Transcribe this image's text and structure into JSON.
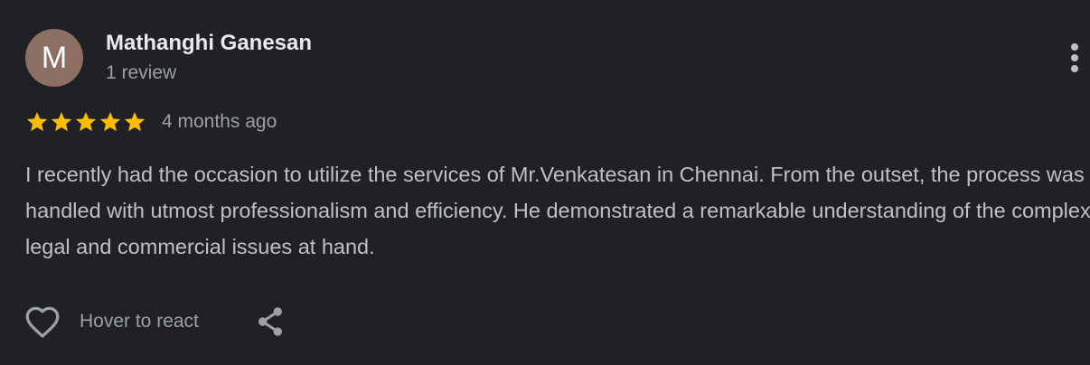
{
  "reviewer": {
    "initial": "M",
    "avatar_color": "#8d6e63",
    "name": "Mathanghi Ganesan",
    "review_count": "1 review"
  },
  "rating": {
    "stars": 5,
    "max_stars": 5,
    "star_color": "#fbbc04",
    "date": "4 months ago"
  },
  "review": {
    "text": "I recently had the occasion to utilize the services of Mr.Venkatesan in Chennai. From the outset, the process was handled with utmost professionalism and efficiency. He demonstrated a remarkable understanding of the complex legal and commercial issues at hand."
  },
  "actions": {
    "react_label": "Hover to react",
    "react_icon": "heart-outline-icon",
    "share_icon": "share-icon",
    "more_icon": "more-vertical-icon"
  },
  "colors": {
    "background": "#202124",
    "icon": "#9aa0a6"
  }
}
